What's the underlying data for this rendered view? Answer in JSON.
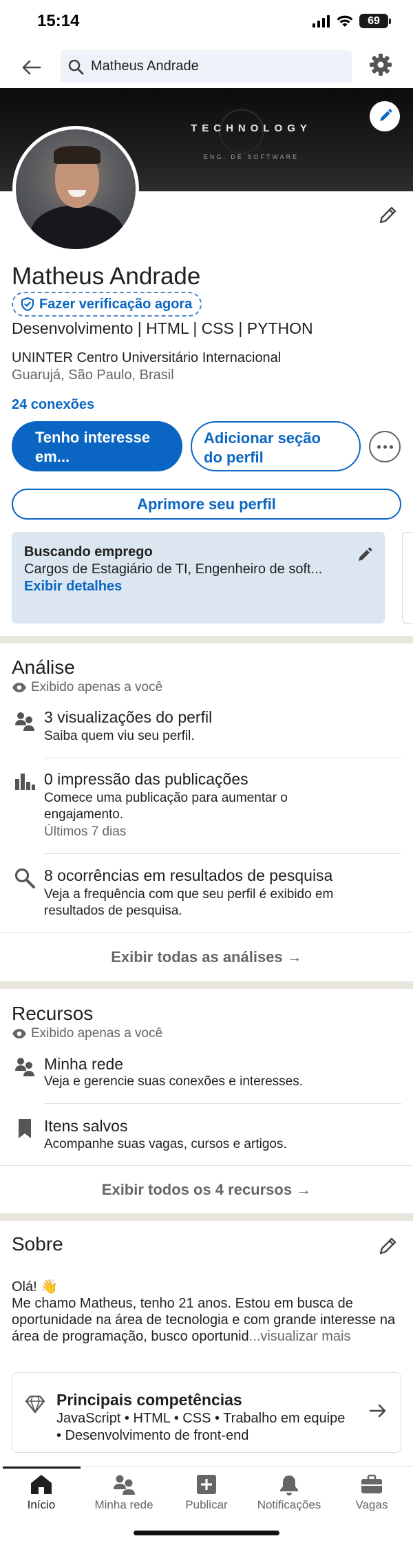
{
  "status_bar": {
    "time": "15:14",
    "battery": "69"
  },
  "search": {
    "value": "Matheus Andrade"
  },
  "banner": {
    "title": "TECHNOLOGY",
    "subtitle": "ENG. DE SOFTWARE"
  },
  "profile": {
    "name": "Matheus Andrade",
    "verify_label": "Fazer verificação agora",
    "headline": "Desenvolvimento | HTML | CSS | PYTHON",
    "education": "UNINTER Centro Universitário Internacional",
    "location": "Guarujá, São Paulo, Brasil",
    "connections": "24 conexões"
  },
  "actions": {
    "interest_line1": "Tenho interesse",
    "interest_line2": "em...",
    "add_section_line1": "Adicionar seção",
    "add_section_line2": "do perfil",
    "improve": "Aprimore seu perfil"
  },
  "job_card": {
    "title": "Buscando emprego",
    "description": "Cargos de Estagiário de TI, Engenheiro de soft...",
    "link": "Exibir detalhes"
  },
  "analytics": {
    "title": "Análise",
    "visibility": "Exibido apenas a você",
    "items": [
      {
        "title": "3 visualizações do perfil",
        "subtitle": "Saiba quem viu seu perfil."
      },
      {
        "title": "0 impressão das publicações",
        "subtitle": "Comece uma publicação para aumentar o engajamento.",
        "meta": "Últimos 7 dias"
      },
      {
        "title": "8 ocorrências em resultados de pesquisa",
        "subtitle": "Veja a frequência com que seu perfil é exibido em resultados de pesquisa."
      }
    ],
    "show_all": "Exibir todas as análises →"
  },
  "resources": {
    "title": "Recursos",
    "visibility": "Exibido apenas a você",
    "items": [
      {
        "title": "Minha rede",
        "subtitle": "Veja e gerencie suas conexões e interesses."
      },
      {
        "title": "Itens salvos",
        "subtitle": "Acompanhe suas vagas, cursos e artigos."
      }
    ],
    "show_all": "Exibir todos os 4 recursos →"
  },
  "about": {
    "title": "Sobre",
    "greeting": "Olá! 👋",
    "text": "Me chamo Matheus, tenho 21 anos. Estou em busca de oportunidade na área de tecnologia e com grande interesse na área de programação, busco oportunid",
    "see_more": "...visualizar mais",
    "skills_title": "Principais competências",
    "skills_list": "JavaScript • HTML • CSS • Trabalho em equipe • Desenvolvimento de front-end"
  },
  "bottom_nav": [
    {
      "label": "Início",
      "icon": "home-icon"
    },
    {
      "label": "Minha rede",
      "icon": "network-icon"
    },
    {
      "label": "Publicar",
      "icon": "post-icon"
    },
    {
      "label": "Notificações",
      "icon": "bell-icon"
    },
    {
      "label": "Vagas",
      "icon": "briefcase-icon"
    }
  ],
  "colors": {
    "accent": "#0a66c2",
    "job_card_bg": "#dce6f1",
    "divider": "#e9e5df"
  }
}
